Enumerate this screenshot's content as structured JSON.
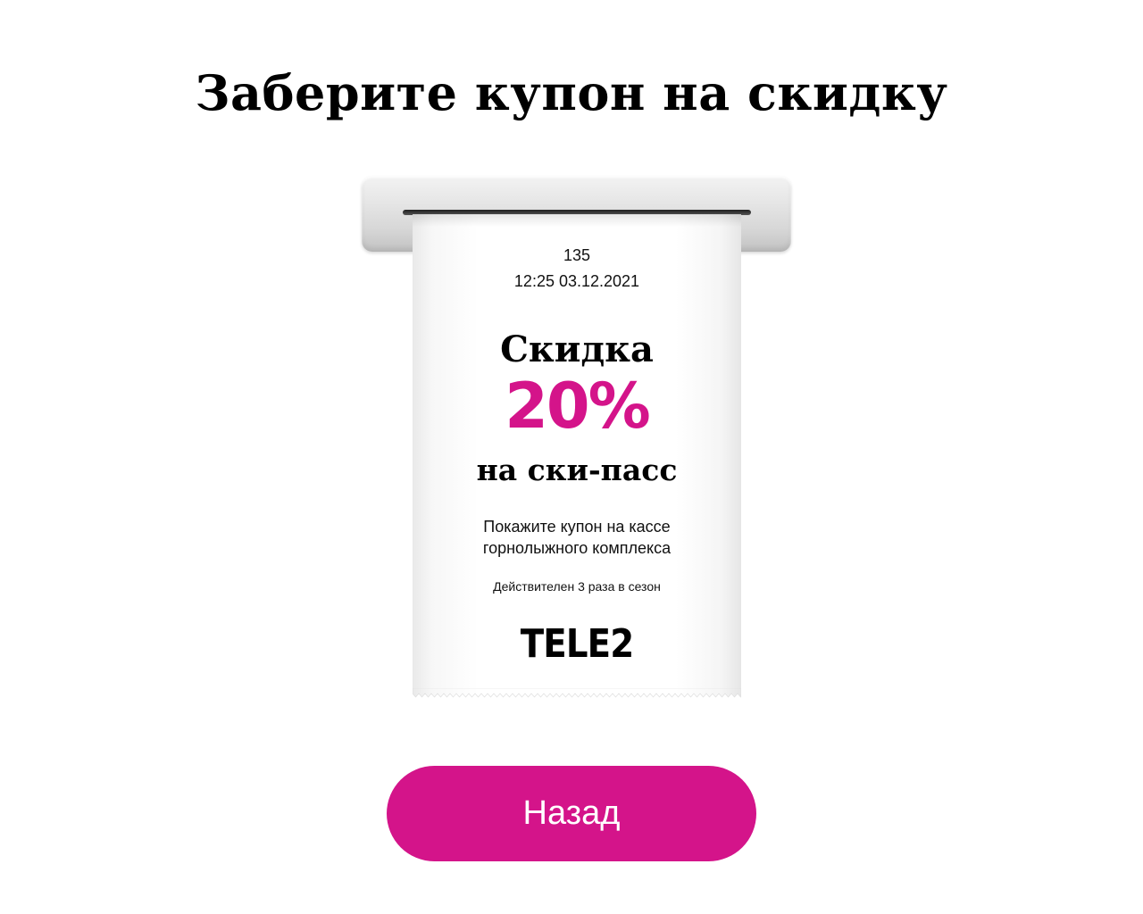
{
  "header": {
    "title": "Заберите купон на скидку"
  },
  "coupon": {
    "number": "135",
    "datetime": "12:25 03.12.2021",
    "discount_label": "Скидка",
    "discount_value": "20%",
    "discount_subject": "на ски-пасс",
    "instruction_line1": "Покажите купон на кассе",
    "instruction_line2": "горнолыжного комплекса",
    "validity": "Действителен 3 раза в сезон",
    "brand_logo": "TELE2"
  },
  "actions": {
    "back_label": "Назад"
  },
  "colors": {
    "accent": "#d4148a",
    "text": "#000000",
    "background": "#ffffff"
  }
}
